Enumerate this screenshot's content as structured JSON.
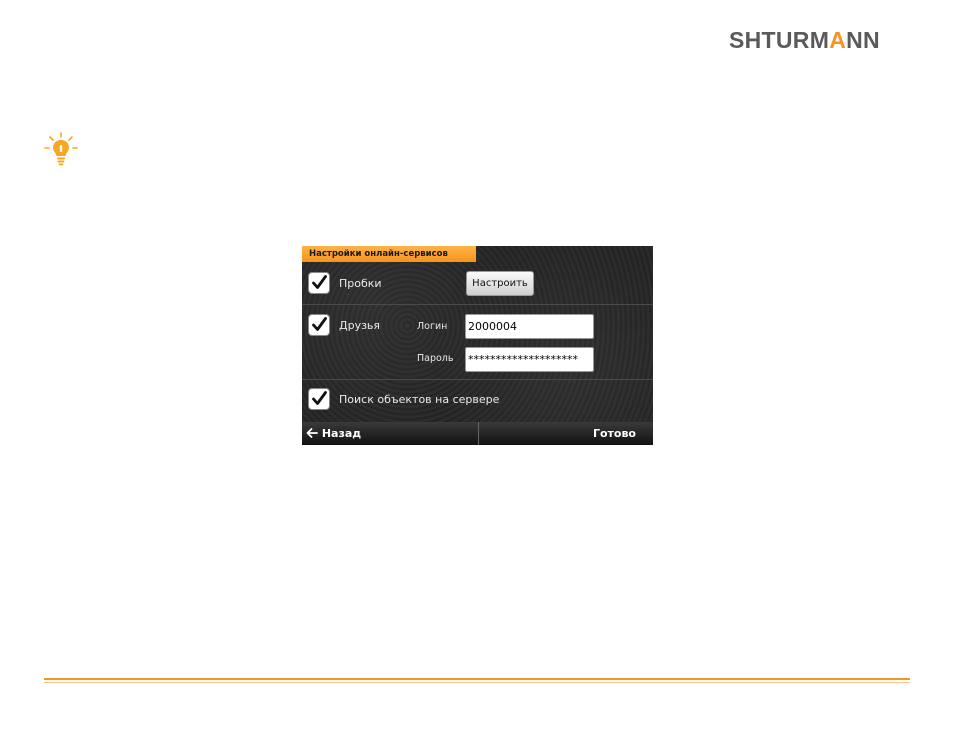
{
  "brand": {
    "logo_prefix": "SHTURM",
    "logo_accent": "A",
    "logo_suffix": "NN",
    "accent_color": "#f7931e",
    "text_color": "#5a5a5a"
  },
  "tip_icon": "lightbulb-icon",
  "dialog": {
    "title": "Настройки онлайн-сервисов",
    "traffic": {
      "checked": true,
      "label": "Пробки",
      "setup_button": "Настроить"
    },
    "friends": {
      "checked": true,
      "label": "Друзья",
      "login_label": "Логин",
      "login_value": "2000004",
      "password_label": "Пароль",
      "password_value": "********************"
    },
    "server_search": {
      "checked": true,
      "label": "Поиск объектов на сервере"
    },
    "back_button": "Назад",
    "back_icon": "arrow-left-icon",
    "done_button": "Готово"
  }
}
